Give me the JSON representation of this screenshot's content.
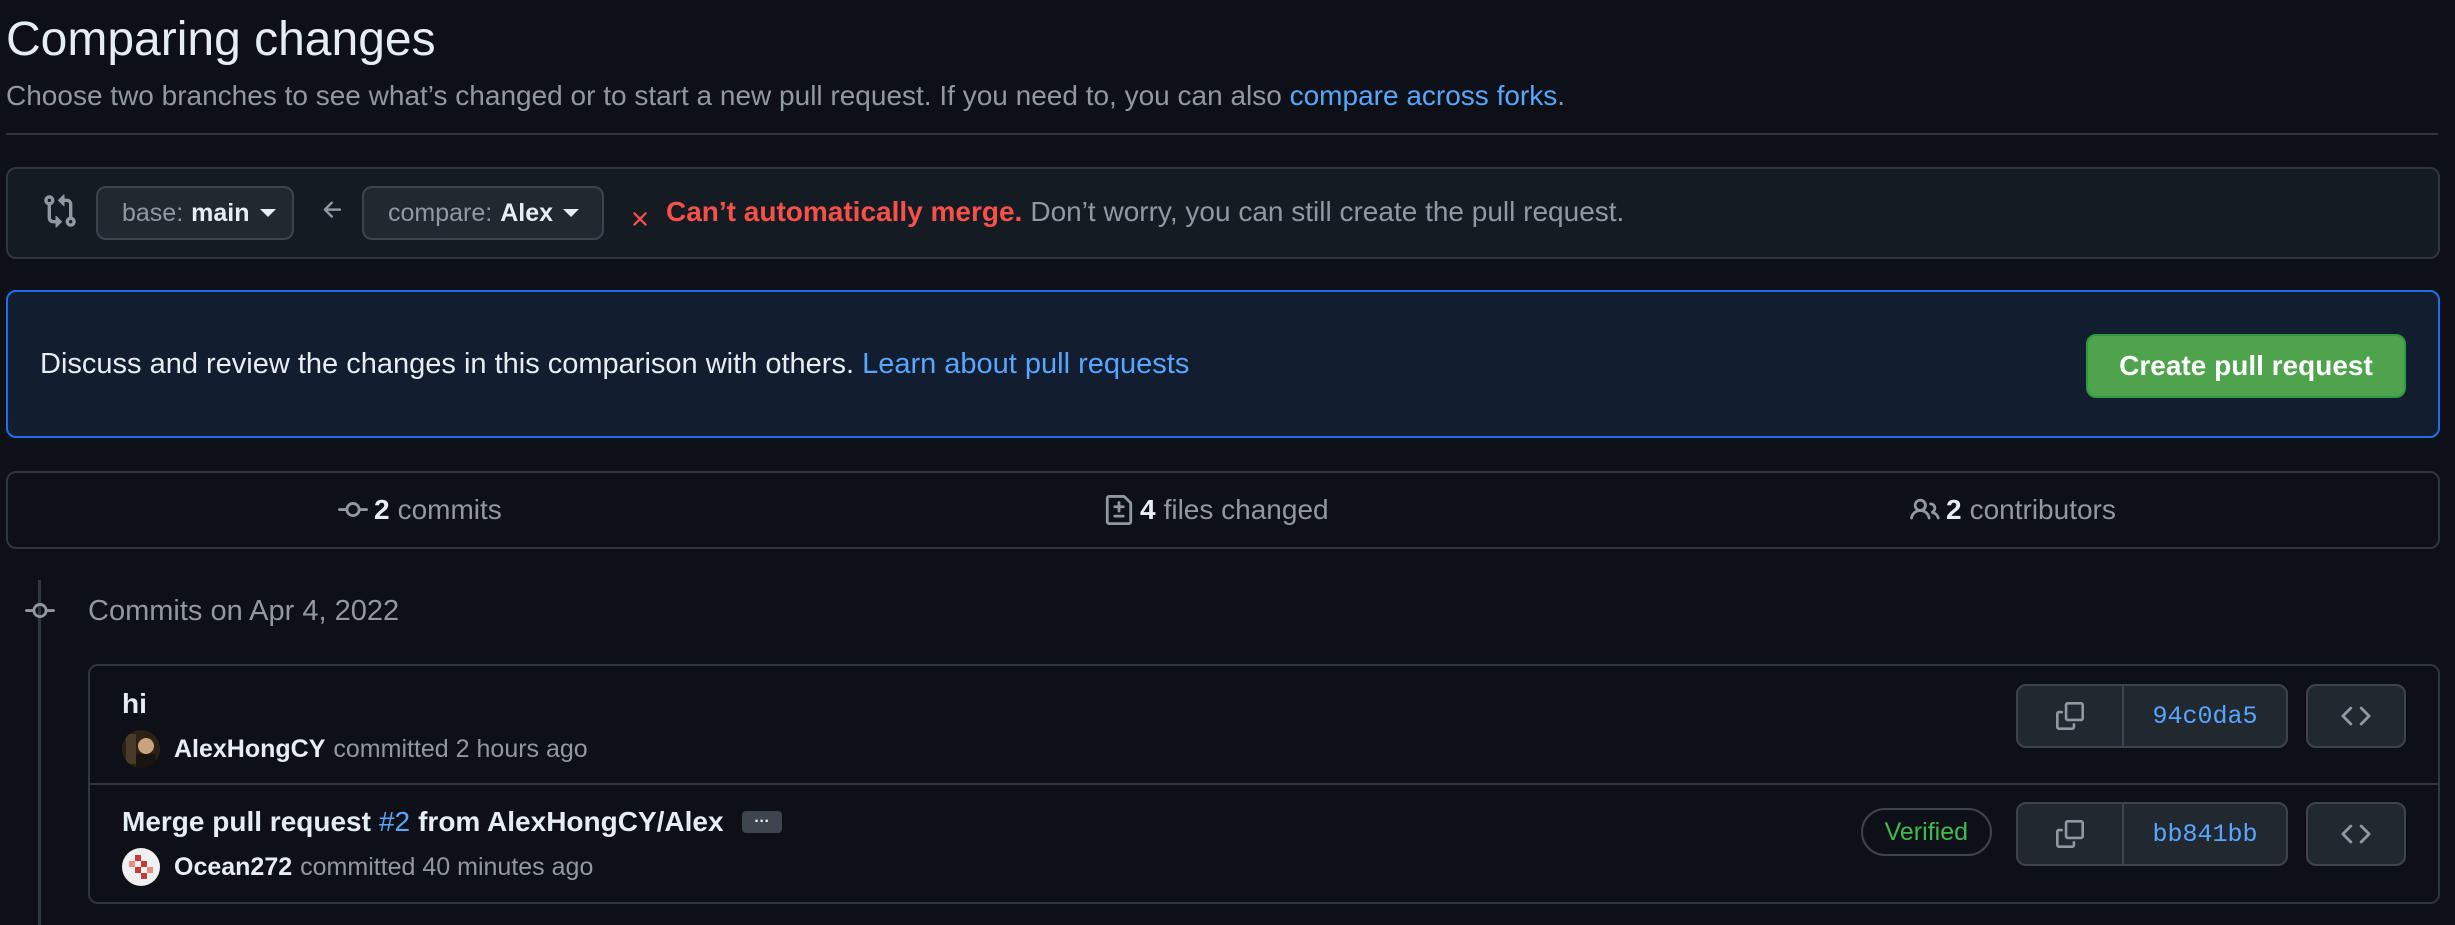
{
  "header": {
    "title": "Comparing changes",
    "subtitle_prefix": "Choose two branches to see what’s changed or to start a new pull request. If you need to, you can also",
    "subtitle_link": "compare across forks",
    "subtitle_suffix": "."
  },
  "range": {
    "base_prefix": "base:",
    "base_branch": "main",
    "compare_prefix": "compare:",
    "compare_branch": "Alex",
    "merge_error": "Can’t automatically merge.",
    "merge_note": "Don’t worry, you can still create the pull request."
  },
  "banner": {
    "text": "Discuss and review the changes in this comparison with others.",
    "link": "Learn about pull requests",
    "button": "Create pull request"
  },
  "stats": {
    "commits_count": "2",
    "commits_label": "commits",
    "files_count": "4",
    "files_label": "files changed",
    "contributors_count": "2",
    "contributors_label": "contributors"
  },
  "commits_header": "Commits on Apr 4, 2022",
  "commits": [
    {
      "title": "hi",
      "author": "AlexHongCY",
      "meta": "committed 2 hours ago",
      "sha": "94c0da5"
    },
    {
      "title_prefix": "Merge pull request",
      "pr_link": "#2",
      "title_suffix": "from AlexHongCY/Alex",
      "ellipsis": "…",
      "author": "Ocean272",
      "meta": "committed 40 minutes ago",
      "verified": "Verified",
      "sha": "bb841bb"
    }
  ],
  "colors": {
    "background": "#0d1117",
    "link": "#58a6ff",
    "error": "#f85149",
    "success_button": "#4ea34c",
    "verified": "#3fb950"
  }
}
